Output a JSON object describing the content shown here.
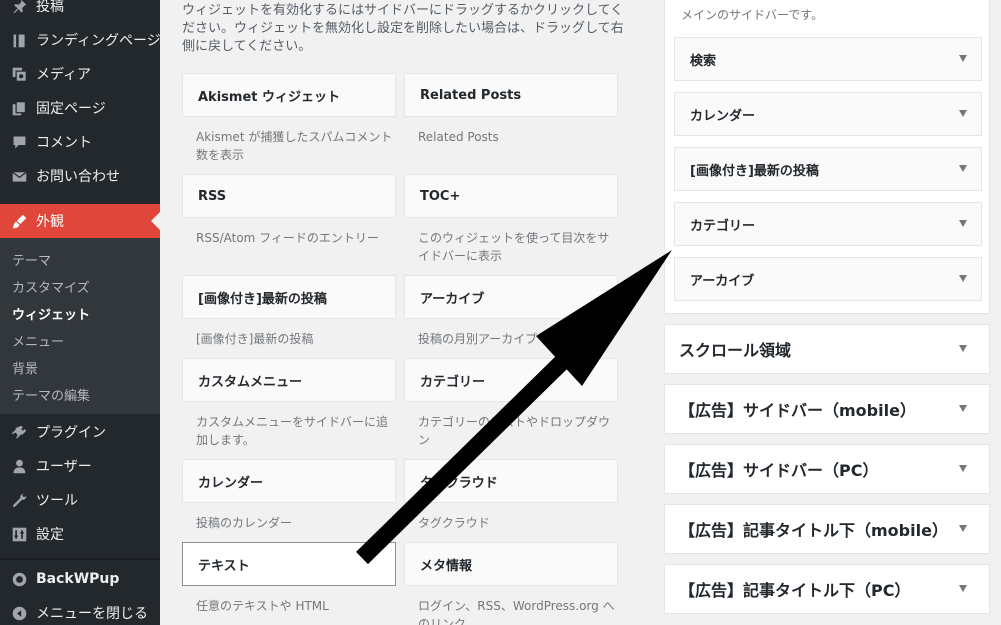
{
  "menu": {
    "items": [
      {
        "label": "投稿",
        "icon": "pin-icon"
      },
      {
        "label": "ランディングページ",
        "icon": "landing-page-icon"
      },
      {
        "label": "メディア",
        "icon": "media-icon"
      },
      {
        "label": "固定ページ",
        "icon": "pages-icon"
      },
      {
        "label": "コメント",
        "icon": "comment-icon"
      },
      {
        "label": "お問い合わせ",
        "icon": "mail-icon"
      },
      {
        "label": "外観",
        "icon": "appearance-brush-icon"
      },
      {
        "label": "プラグイン",
        "icon": "plugin-icon"
      },
      {
        "label": "ユーザー",
        "icon": "user-icon"
      },
      {
        "label": "ツール",
        "icon": "wrench-icon"
      },
      {
        "label": "設定",
        "icon": "settings-icon"
      },
      {
        "label": "BackWPup",
        "icon": "backwpup-icon"
      },
      {
        "label": "メニューを閉じる",
        "icon": "collapse-icon"
      }
    ],
    "submenu": [
      "テーマ",
      "カスタマイズ",
      "ウィジェット",
      "メニュー",
      "背景",
      "テーマの編集"
    ]
  },
  "main": {
    "description": "ウィジェットを有効化するにはサイドバーにドラッグするかクリックしてください。ウィジェットを無効化し設定を削除したい場合は、ドラッグして右側に戻してください。",
    "widgets": [
      {
        "title": "Akismet ウィジェット",
        "desc": "Akismet が捕獲したスパムコメント数を表示"
      },
      {
        "title": "Related Posts",
        "desc": "Related Posts"
      },
      {
        "title": "RSS",
        "desc": "RSS/Atom フィードのエントリー"
      },
      {
        "title": "TOC+",
        "desc": "このウィジェットを使って目次をサイドバーに表示"
      },
      {
        "title": "[画像付き]最新の投稿",
        "desc": "[画像付き]最新の投稿"
      },
      {
        "title": "アーカイブ",
        "desc": "投稿の月別アーカイブ"
      },
      {
        "title": "カスタムメニュー",
        "desc": "カスタムメニューをサイドバーに追加します。"
      },
      {
        "title": "カテゴリー",
        "desc": "カテゴリーのリストやドロップダウン"
      },
      {
        "title": "カレンダー",
        "desc": "投稿のカレンダー"
      },
      {
        "title": "タグクラウド",
        "desc": "タグクラウド"
      },
      {
        "title": "テキスト",
        "desc": "任意のテキストや HTML"
      },
      {
        "title": "メタ情報",
        "desc": "ログイン、RSS、WordPress.org へのリンク"
      }
    ]
  },
  "sidebar": {
    "description": "メインのサイドバーです。",
    "widgets": [
      "検索",
      "カレンダー",
      "[画像付き]最新の投稿",
      "カテゴリー",
      "アーカイブ"
    ]
  },
  "areas": [
    "スクロール領域",
    "【広告】サイドバー（mobile）",
    "【広告】サイドバー（PC）",
    "【広告】記事タイトル下（mobile）",
    "【広告】記事タイトル下（PC）"
  ]
}
